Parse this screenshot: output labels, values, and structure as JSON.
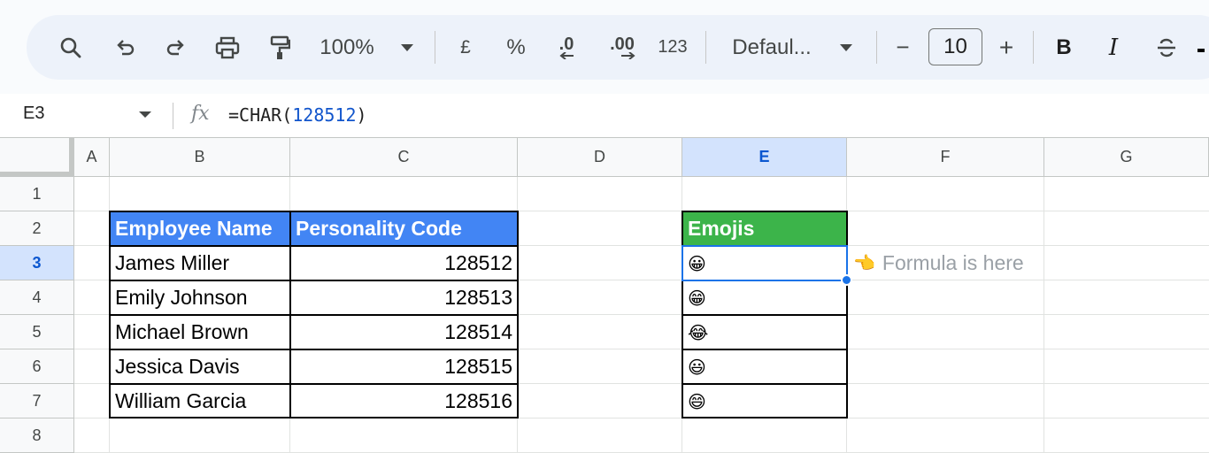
{
  "toolbar": {
    "zoom": "100%",
    "currency_label": "£",
    "percent_label": "%",
    "decrease_decimal_label": ".0",
    "increase_decimal_label": ".00",
    "more_formats_label": "123",
    "font_name": "Defaul...",
    "font_size": "10",
    "minus_label": "−",
    "plus_label": "+",
    "bold_label": "B",
    "italic_label": "I"
  },
  "formula_bar": {
    "cell_ref": "E3",
    "fx_label": "fx",
    "formula_prefix": "=CHAR(",
    "formula_number": "128512",
    "formula_suffix": ")"
  },
  "columns": [
    "A",
    "B",
    "C",
    "D",
    "E",
    "F",
    "G"
  ],
  "rows": [
    "1",
    "2",
    "3",
    "4",
    "5",
    "6",
    "7",
    "8"
  ],
  "table": {
    "headers": [
      "Employee Name",
      "Personality Code"
    ],
    "names": [
      "James Miller",
      "Emily Johnson",
      "Michael Brown",
      "Jessica Davis",
      "William Garcia"
    ],
    "codes": [
      "128512",
      "128513",
      "128514",
      "128515",
      "128516"
    ]
  },
  "emoji_table": {
    "header": "Emojis",
    "emojis": [
      "😀",
      "😁",
      "😂",
      "😃",
      "😄"
    ]
  },
  "annotation": {
    "hand": "👈",
    "text": "Formula is here"
  },
  "colors": {
    "header_blue": "#4285f4",
    "header_green": "#3cb44a",
    "selection": "#1a73e8"
  }
}
